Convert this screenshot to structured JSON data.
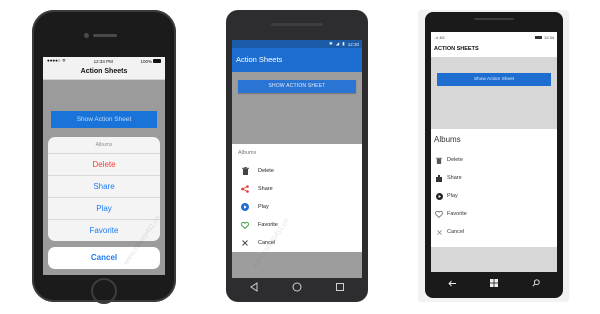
{
  "ios": {
    "status": {
      "carrier": "●●●●○ ᯤ",
      "time": "12:34 PM",
      "battery": "100%"
    },
    "nav_title": "Action Sheets",
    "show_button": "Show Action Sheet",
    "sheet_title": "Albums",
    "options": [
      "Delete",
      "Share",
      "Play",
      "Favorite"
    ],
    "cancel": "Cancel",
    "watermark": "www.csharp411.cn"
  },
  "android": {
    "status_time": "12:30",
    "toolbar_title": "Action Sheets",
    "show_button": "SHOW ACTION SHEET",
    "sheet_title": "Albums",
    "options": [
      {
        "label": "Delete",
        "icon": "trash-icon",
        "color": "#444444"
      },
      {
        "label": "Share",
        "icon": "share-icon",
        "color": "#e53935"
      },
      {
        "label": "Play",
        "icon": "play-icon",
        "color": "#1e6ed1"
      },
      {
        "label": "Favorite",
        "icon": "heart-icon",
        "color": "#2e9d3b"
      },
      {
        "label": "Cancel",
        "icon": "close-icon",
        "color": "#444444"
      }
    ],
    "watermark": "www.csharp411.cn"
  },
  "windows": {
    "status_signal": "..ıl 4G",
    "status_time": "12:34",
    "page_title": "ACTION SHEETS",
    "show_button": "Show Action Sheet",
    "sheet_title": "Albums",
    "options": [
      {
        "label": "Delete",
        "icon": "trash-icon"
      },
      {
        "label": "Share",
        "icon": "share-icon"
      },
      {
        "label": "Play",
        "icon": "play-icon"
      },
      {
        "label": "Favorite",
        "icon": "heart-icon"
      },
      {
        "label": "Cancel",
        "icon": "close-icon"
      }
    ]
  },
  "colors": {
    "ios_blue": "#1a7bf5",
    "ios_destructive": "#ff3b30",
    "android_primary": "#1e6ed1",
    "android_dark": "#1a5aa6"
  }
}
